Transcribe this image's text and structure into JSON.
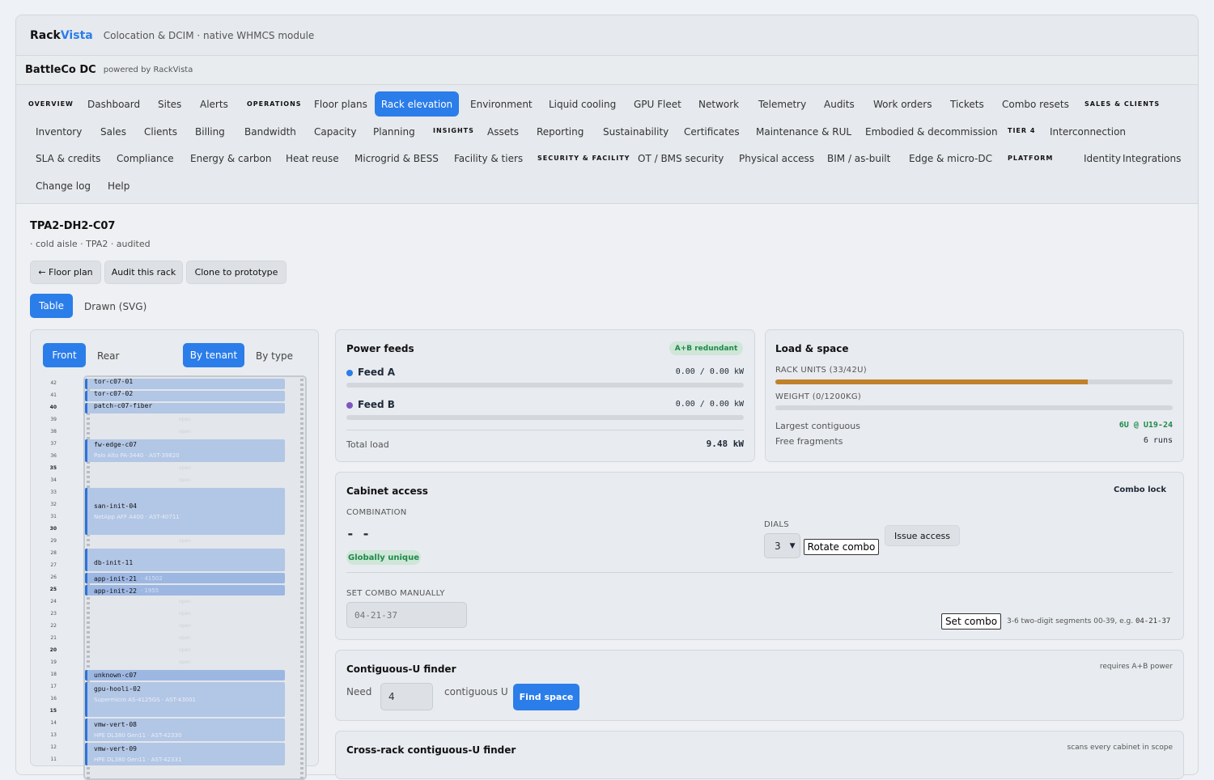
{
  "brand": {
    "name_a": "Rack",
    "name_b": "Vista",
    "tagline": "Colocation & DCIM · native WHMCS module"
  },
  "tenant": {
    "name": "BattleCo DC",
    "powered": "powered by RackVista"
  },
  "nav": {
    "sections": {
      "overview": "OVERVIEW",
      "operations": "OPERATIONS",
      "sales": "SALES & CLIENTS",
      "insights": "INSIGHTS",
      "tier4": "TIER 4",
      "security": "SECURITY & FACILITY",
      "platform": "PLATFORM"
    },
    "items": [
      "Dashboard",
      "Sites",
      "Alerts",
      "Floor plans",
      "Rack elevation",
      "Environment",
      "Liquid cooling",
      "GPU Fleet",
      "Network",
      "Telemetry",
      "Audits",
      "Work orders",
      "Tickets",
      "Combo resets",
      "Inventory",
      "Sales",
      "Clients",
      "Billing",
      "Bandwidth",
      "Capacity",
      "Planning",
      "Assets",
      "Reporting",
      "Sustainability",
      "Certificates",
      "Maintenance & RUL",
      "Embodied & decommission",
      "Interconnection",
      "SLA & credits",
      "Compliance",
      "Energy & carbon",
      "Heat reuse",
      "Microgrid & BESS",
      "Facility & tiers",
      "OT / BMS security",
      "Physical access",
      "BIM / as-built",
      "Edge & micro-DC",
      "Identity",
      "Integrations",
      "Change log",
      "Help"
    ]
  },
  "rack": {
    "title": "TPA2-DH2-C07",
    "subtitle": "· cold aisle · TPA2 · audited"
  },
  "actions": {
    "floor_plan": "← Floor plan",
    "audit": "Audit this rack",
    "clone": "Clone to prototype"
  },
  "view_tabs": {
    "table": "Table",
    "drawn": "Drawn (SVG)"
  },
  "elevation": {
    "front": "Front",
    "rear": "Rear",
    "by_tenant": "By tenant",
    "by_type": "By type",
    "units": [
      "42",
      "41",
      "40",
      "39",
      "38",
      "37",
      "36",
      "35",
      "34",
      "33",
      "32",
      "31",
      "30",
      "29",
      "28",
      "27",
      "26",
      "25",
      "24",
      "23",
      "22",
      "21",
      "20",
      "19",
      "18",
      "17",
      "16",
      "15",
      "14",
      "13",
      "12",
      "11"
    ],
    "open_label": "open",
    "devices": [
      {
        "name": "tor-c07-01"
      },
      {
        "name": "tor-c07-02"
      },
      {
        "name": "patch-c07-fiber"
      },
      {
        "name": "fw-edge-c07",
        "sub": "Palo Alto PA-3440 · AST-39820"
      },
      {
        "name": "san-init-04",
        "sub": "NetApp AFF A400 · AST-40711"
      },
      {
        "name": "db-init-11"
      },
      {
        "name": "app-init-21",
        "extra": "· 41502"
      },
      {
        "name": "app-init-22",
        "extra": "· 1955"
      },
      {
        "name": "unknown-c07"
      },
      {
        "name": "gpu-hooli-02",
        "sub": "Supermicro AS-4125GS · AST-43001"
      },
      {
        "name": "vmw-vert-08",
        "sub": "HPE DL380 Gen11 · AST-42330"
      },
      {
        "name": "vmw-vert-09",
        "sub": "HPE DL380 Gen11 · AST-42331"
      }
    ]
  },
  "power": {
    "title": "Power feeds",
    "badge": "A+B redundant",
    "feed_a": {
      "label": "Feed A",
      "dash": "-",
      "value": "0.00 / 0.00 kW",
      "color": "#2b7de9",
      "fraction": 0
    },
    "feed_b": {
      "label": "Feed B",
      "dash": "-",
      "value": "0.00 / 0.00 kW",
      "color": "#7e57c2",
      "fraction": 0
    },
    "total_label": "Total load",
    "total_value": "9.48 kW"
  },
  "load": {
    "title": "Load & space",
    "rack_units": {
      "label": "RACK UNITS (33/42U)",
      "fraction": 0.786
    },
    "weight": {
      "label": "WEIGHT (0/1200KG)",
      "fraction": 0
    },
    "largest_label": "Largest contiguous",
    "largest_value": "6U @ U19-24",
    "fragments_label": "Free fragments",
    "fragments_value": "6 runs"
  },
  "cabinet": {
    "title": "Cabinet access",
    "lock": "Combo lock",
    "combination_label": "COMBINATION",
    "combination_value": "- -",
    "unique_badge": "Globally unique",
    "dials_label": "DIALS",
    "dials_value": "3",
    "rotate": "Rotate combo",
    "issue": "Issue access",
    "manual_label": "SET COMBO MANUALLY",
    "manual_placeholder": "04-21-37",
    "set": "Set combo",
    "hint_prefix": "3-6 two-digit segments 00-39, e.g.",
    "hint_example": "04-21-37"
  },
  "finder": {
    "title": "Contiguous-U finder",
    "note": "requires A+B power",
    "need": "Need",
    "need_value": "4",
    "unit": "contiguous U",
    "find": "Find space"
  },
  "cross": {
    "title": "Cross-rack contiguous-U finder",
    "note": "scans every cabinet in scope"
  }
}
